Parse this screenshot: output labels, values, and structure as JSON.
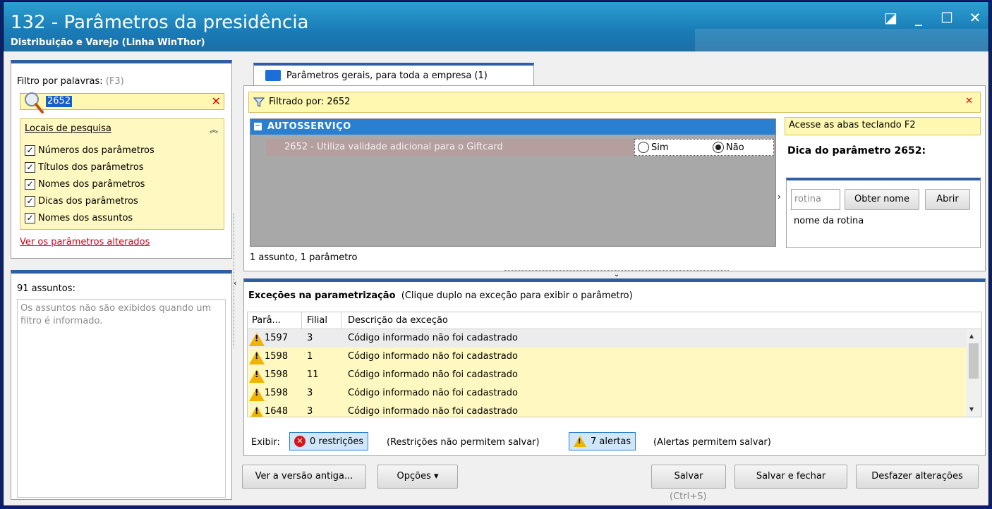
{
  "window": {
    "title": "132 - Parâmetros da presidência",
    "subtitle": "Distribuição e Varejo (Linha WinThor)",
    "controls": {
      "restore": "◪",
      "minimize": "_",
      "maximize": "☐",
      "close": "✕"
    }
  },
  "filter": {
    "label": "Filtro por palavras:",
    "hint": "(F3)",
    "value": "2652",
    "clear": "✕",
    "locais_title": "Locais de pesquisa",
    "locais_collapse": "︽",
    "options": [
      {
        "label": "Números dos parâmetros",
        "checked": true
      },
      {
        "label": "Títulos dos parâmetros",
        "checked": true
      },
      {
        "label": "Nomes dos parâmetros",
        "checked": true
      },
      {
        "label": "Dicas dos parâmetros",
        "checked": true
      },
      {
        "label": "Nomes dos assuntos",
        "checked": true
      }
    ],
    "changed_link": "Ver os parâmetros alterados"
  },
  "assuntos": {
    "count": "91 assuntos:",
    "empty_msg": "Os assuntos não são exibidos quando um filtro é informado."
  },
  "tab": {
    "label": "Parâmetros gerais, para toda a empresa  (1)",
    "filtered_text": "Filtrado por: 2652",
    "filtered_clear": "✕"
  },
  "grid": {
    "group": "AUTOSSERVIÇO",
    "row_text": "2652 - Utiliza validade adicional para o Giftcard",
    "radio_yes": "Sim",
    "radio_no": "Não",
    "selected": "Não",
    "summary": "1 assunto, 1 parâmetro"
  },
  "tip": {
    "box": "Acesse as abas teclando F2",
    "title": "Dica do parâmetro 2652:",
    "rotina_placeholder": "rotina",
    "get_name": "Obter nome",
    "open": "Abrir",
    "rotina_name": "nome da rotina"
  },
  "exceptions": {
    "title": "Exceções na parametrização",
    "hint": "(Clique duplo na exceção para exibir o parâmetro)",
    "headers": [
      "Parâ...",
      "Filial",
      "Descrição da exceção"
    ],
    "rows": [
      {
        "param": "1597",
        "filial": "3",
        "desc": "Código informado não foi cadastrado"
      },
      {
        "param": "1598",
        "filial": "1",
        "desc": "Código informado não foi cadastrado"
      },
      {
        "param": "1598",
        "filial": "11",
        "desc": "Código informado não foi cadastrado"
      },
      {
        "param": "1598",
        "filial": "3",
        "desc": "Código informado não foi cadastrado"
      },
      {
        "param": "1648",
        "filial": "3",
        "desc": "Código informado não foi cadastrado"
      }
    ],
    "exibir": "Exibir:",
    "restricoes_btn": "0 restrições",
    "restricoes_note": "(Restrições não permitem salvar)",
    "alertas_btn": "7 alertas",
    "alertas_note": "(Alertas permitem salvar)"
  },
  "buttons": {
    "old_version": "Ver a versão antiga...",
    "options": "Opções ▾",
    "save": "Salvar",
    "save_hint": "(Ctrl+S)",
    "save_close": "Salvar e fechar",
    "undo": "Desfazer alterações"
  }
}
